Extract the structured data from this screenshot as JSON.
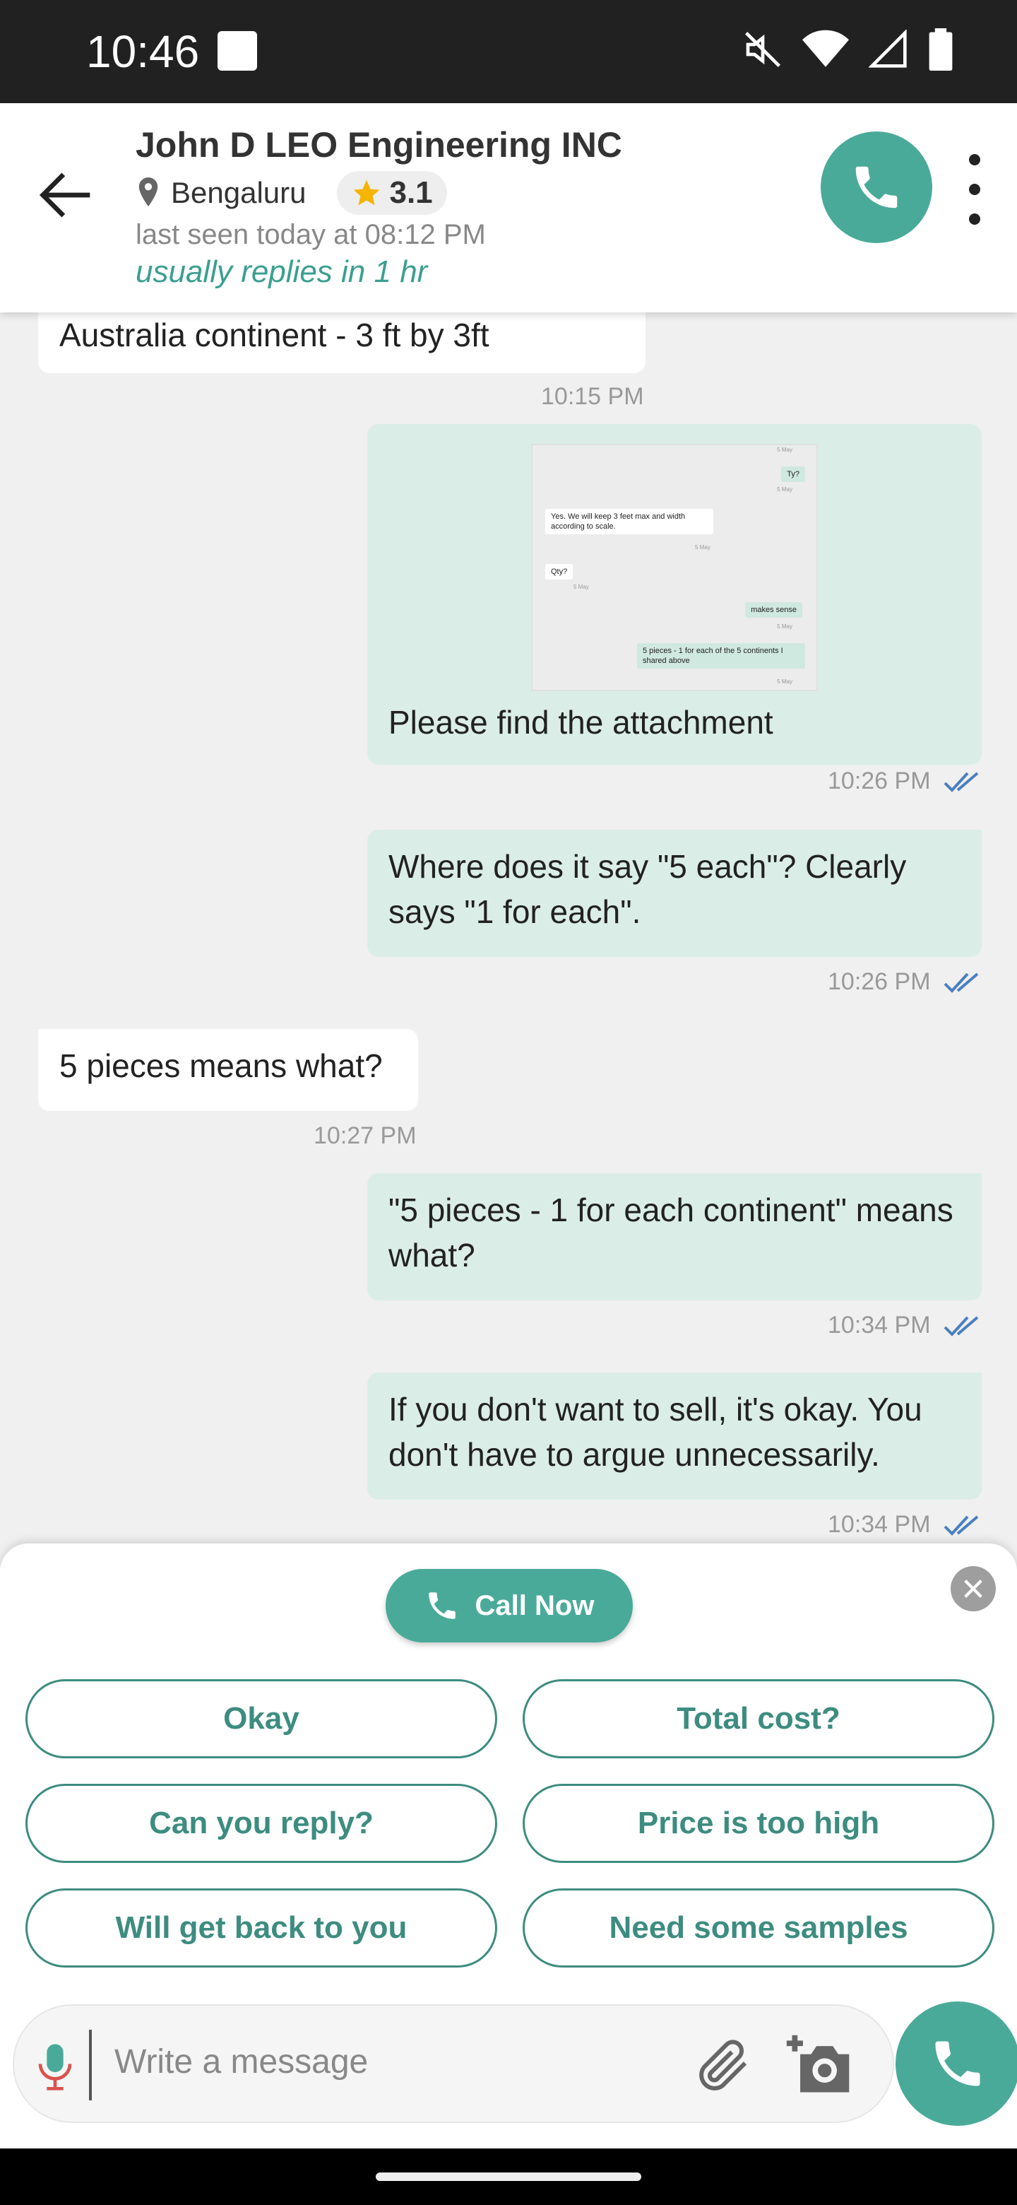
{
  "status_bar": {
    "time": "10:46"
  },
  "header": {
    "title": "John D LEO Engineering INC",
    "location": "Bengaluru",
    "rating": "3.1",
    "last_seen": "last seen today at 08:12 PM",
    "reply_time": "usually replies in 1 hr"
  },
  "messages": [
    {
      "dir": "in",
      "text": "Australia continent - 3 ft by 3ft",
      "time": "10:15 PM"
    },
    {
      "dir": "out",
      "text": "Please find the attachment",
      "time": "10:26 PM",
      "attachment": {
        "lines": [
          {
            "dir": "out",
            "text": "Ty?",
            "time": "5 May"
          },
          {
            "dir": "in",
            "text": "Yes. We will keep 3 feet max and width according to scale.",
            "time": "5 May"
          },
          {
            "dir": "in",
            "text": "Qty?",
            "time": "5 May"
          },
          {
            "dir": "out",
            "text": "makes sense",
            "time": "5 May"
          },
          {
            "dir": "out",
            "text": "5 pieces - 1 for each of the 5 continents I shared above",
            "time": "5 May"
          }
        ],
        "top_time": "5 May"
      }
    },
    {
      "dir": "out",
      "text": "Where does it say \"5 each\"? Clearly says \"1 for each\".",
      "time": "10:26 PM"
    },
    {
      "dir": "in",
      "text": "5 pieces means what?",
      "time": "10:27 PM"
    },
    {
      "dir": "out",
      "text": "\"5 pieces - 1 for each continent\" means what?",
      "time": "10:34 PM"
    },
    {
      "dir": "out",
      "text": "If you don't want to sell, it's okay. You don't have to argue unnecessarily.",
      "time": "10:34 PM"
    }
  ],
  "quick_replies": {
    "call_now": "Call Now",
    "chips": [
      "Okay",
      "Total cost?",
      "Can you reply?",
      "Price is too high",
      "Will get back to you",
      "Need some samples"
    ]
  },
  "composer": {
    "placeholder": "Write a message"
  },
  "colors": {
    "accent": "#4aaa9a",
    "chip_border": "#3d8c80",
    "outgoing_bubble": "#dbede7",
    "tick_blue": "#4a7fc1"
  },
  "icons": [
    "back-arrow-icon",
    "location-pin-icon",
    "star-icon",
    "phone-icon",
    "more-vert-icon",
    "close-icon",
    "mic-icon",
    "paperclip-icon",
    "add-camera-icon"
  ]
}
